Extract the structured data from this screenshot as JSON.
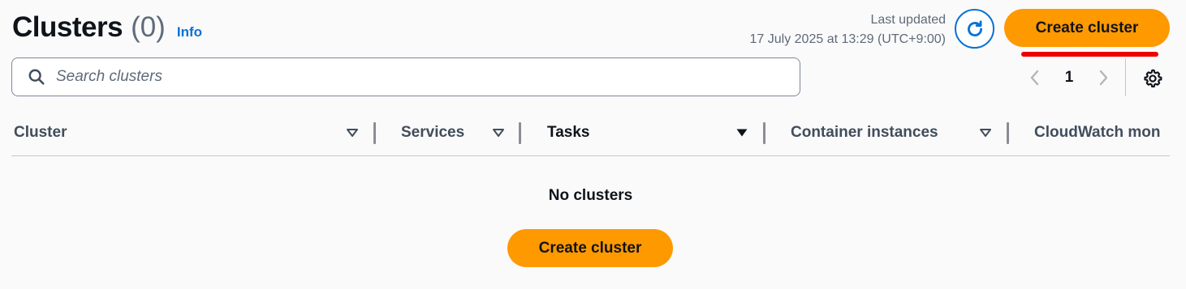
{
  "header": {
    "title": "Clusters",
    "count": "(0)",
    "info_link": "Info",
    "last_updated_label": "Last updated",
    "last_updated_value": "17 July 2025 at 13:29 (UTC+9:00)",
    "create_button": "Create cluster"
  },
  "search": {
    "placeholder": "Search clusters",
    "value": ""
  },
  "pagination": {
    "current_page": "1"
  },
  "table": {
    "columns": [
      {
        "label": "Cluster"
      },
      {
        "label": "Services"
      },
      {
        "label": "Tasks"
      },
      {
        "label": "Container instances"
      },
      {
        "label": "CloudWatch mon"
      }
    ]
  },
  "empty_state": {
    "title": "No clusters",
    "create_button": "Create cluster"
  },
  "colors": {
    "primary_button": "#ff9900",
    "link": "#0972d3",
    "annotation": "#ee0000"
  }
}
